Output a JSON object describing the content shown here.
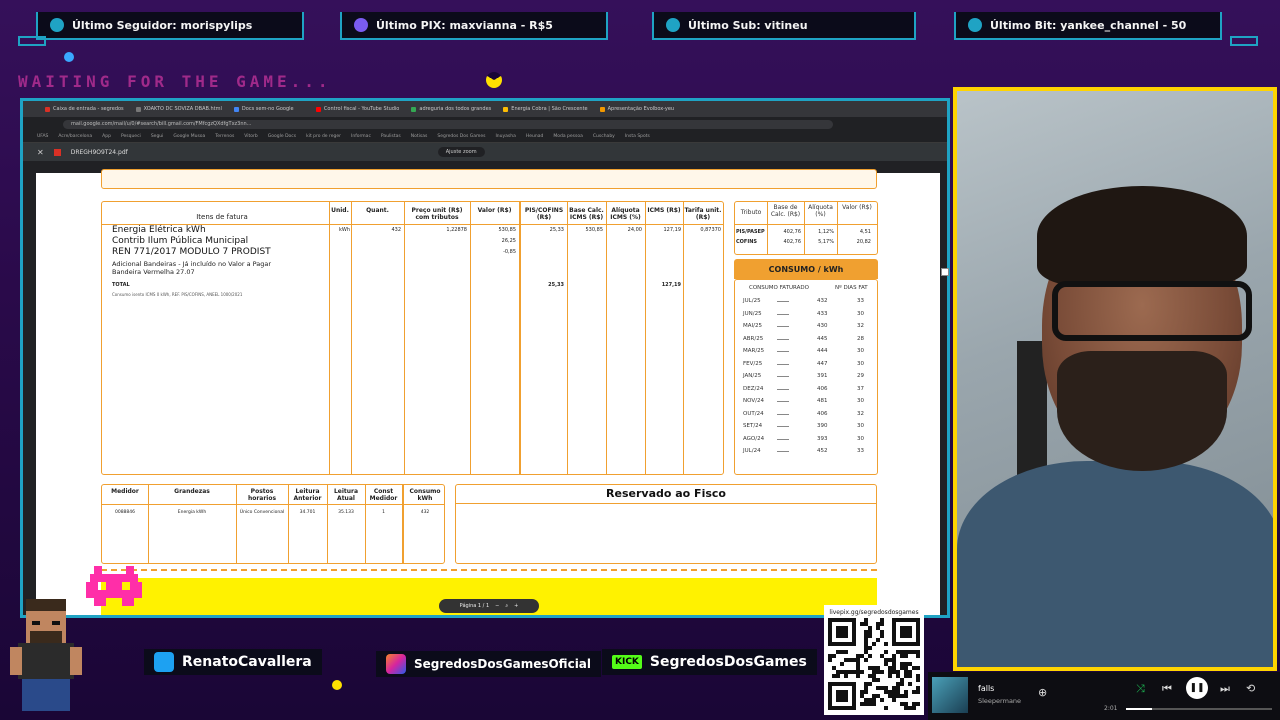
{
  "alerts": [
    {
      "label": "Último Seguidor: morispylips",
      "icon": "person-icon"
    },
    {
      "label": "Último PIX: maxvianna - R$5",
      "icon": "dollar-icon"
    },
    {
      "label": "Último Sub: vitineu",
      "icon": "star-icon"
    },
    {
      "label": "Último Bit: yankee_channel - 50",
      "icon": "heart-icon"
    }
  ],
  "waiting_text": "WAITING FOR THE GAME...",
  "browser": {
    "tabs": [
      "Caixa de entrada - segredos",
      "XOAKTO DC SOVIZA DBAB.html",
      "Docs sem-no Google",
      "Control fiscal - YouTube Studio",
      "adreguria dos todos grandes",
      "Energia Cobra | São Crescente",
      "Apresentação Evolbox-yeu"
    ],
    "url": "mail.google.com/mail/u/0/#search/bill.gmail.com/FMfcgzQXdfgTxz3nn...",
    "bookmarks": [
      "UFAS",
      "Acre/barcelona",
      "App",
      "Pesqueci",
      "Segui",
      "Google Musoa",
      "Terrenos",
      "Vitorb",
      "Google Docs",
      "kit pro de reger",
      "Informac",
      "Paulistas",
      "Notisas",
      "Segredos Dos Games",
      "Inuyasha",
      "Heunad",
      "Moda pessoa",
      "Cuschaby",
      "Insta Spots",
      "kuva Insta Home",
      "Hotkotas"
    ],
    "pdf_name": "DREGH9O9T24.pdf",
    "zoom": "Ajuste zoom"
  },
  "invoice": {
    "items_header": "Itens de fatura",
    "col_headers": [
      "Unid.",
      "Quant.",
      "Preço unit (R$) com tributos",
      "Valor (R$)",
      "PIS/COFINS (R$)",
      "Base Calc. ICMS (R$)",
      "Alíquota ICMS (%)",
      "ICMS (R$)",
      "Tarifa unit. (R$)"
    ],
    "items": [
      "Energia Elétrica kWh",
      "Contrib Ilum Pública Municipal",
      "REN 771/2017 MODULO 7 PRODIST",
      "Adicional Bandeiras - Já incluído no Valor a Pagar",
      "Bandeira Vermelha 27.07"
    ],
    "row1": {
      "unit": "kWh",
      "qty": "432",
      "price": "1,22878",
      "value": "530,85",
      "pis": "25,33",
      "base": "530,85",
      "aliq": "24,00",
      "icms": "127,19",
      "tarifa": "0,87370"
    },
    "row2_value": "26,25",
    "row3_value": "-0,85",
    "total_label": "TOTAL",
    "total_pis": "25,33",
    "total_icms": "127,19",
    "note": "Consumo isento ICMS 0 kWh, REF. PIS/COFINS, ANEEL 1000/2021",
    "tributo": {
      "headers": [
        "Tributo",
        "Base de Calc. (R$)",
        "Alíquota (%)",
        "Valor (R$)"
      ],
      "rows": [
        {
          "name": "PIS/PASEP",
          "base": "402,76",
          "aliq": "1,12%",
          "valor": "4,51"
        },
        {
          "name": "COFINS",
          "base": "402,76",
          "aliq": "5,17%",
          "valor": "20,82"
        }
      ]
    },
    "consumo": {
      "title": "CONSUMO / kWh",
      "col_a": "CONSUMO FATURADO",
      "col_b": "Nº DIAS FAT",
      "rows": [
        {
          "m": "JUL/25",
          "v": "432",
          "d": "33"
        },
        {
          "m": "JUN/25",
          "v": "433",
          "d": "30"
        },
        {
          "m": "MAI/25",
          "v": "430",
          "d": "32"
        },
        {
          "m": "ABR/25",
          "v": "445",
          "d": "28"
        },
        {
          "m": "MAR/25",
          "v": "444",
          "d": "30"
        },
        {
          "m": "FEV/25",
          "v": "447",
          "d": "30"
        },
        {
          "m": "JAN/25",
          "v": "391",
          "d": "29"
        },
        {
          "m": "DEZ/24",
          "v": "406",
          "d": "37"
        },
        {
          "m": "NOV/24",
          "v": "481",
          "d": "30"
        },
        {
          "m": "OUT/24",
          "v": "406",
          "d": "32"
        },
        {
          "m": "SET/24",
          "v": "390",
          "d": "30"
        },
        {
          "m": "AGO/24",
          "v": "393",
          "d": "30"
        },
        {
          "m": "JUL/24",
          "v": "452",
          "d": "33"
        }
      ]
    },
    "medidor": {
      "headers": [
        "Medidor",
        "Grandezas",
        "Postos horarios",
        "Leitura Anterior",
        "Leitura Atual",
        "Const Medidor",
        "Consumo kWh"
      ],
      "row": [
        "0088846",
        "Energia kWh",
        "Único Convencional",
        "34.701",
        "35.133",
        "1",
        "432"
      ]
    },
    "fisco": "Reservado ao Fisco",
    "pager": "Página 1 / 1"
  },
  "socials": [
    {
      "label": "RenatoCavallera",
      "icon": "twitter-icon",
      "color": "#1da1f2"
    },
    {
      "label": "SegredosDosGamesOficial",
      "icon": "instagram-icon",
      "color": "#d6249f"
    },
    {
      "label": "SegredosDosGames",
      "icon": "kick-icon",
      "color": "#53fc18"
    }
  ],
  "kick_badge": "KICK",
  "qr_label": "livepix.gg/segredosdosgames",
  "player": {
    "track": "falls",
    "artist": "Sleepermane",
    "time": "2:01",
    "progress": 0.18
  }
}
